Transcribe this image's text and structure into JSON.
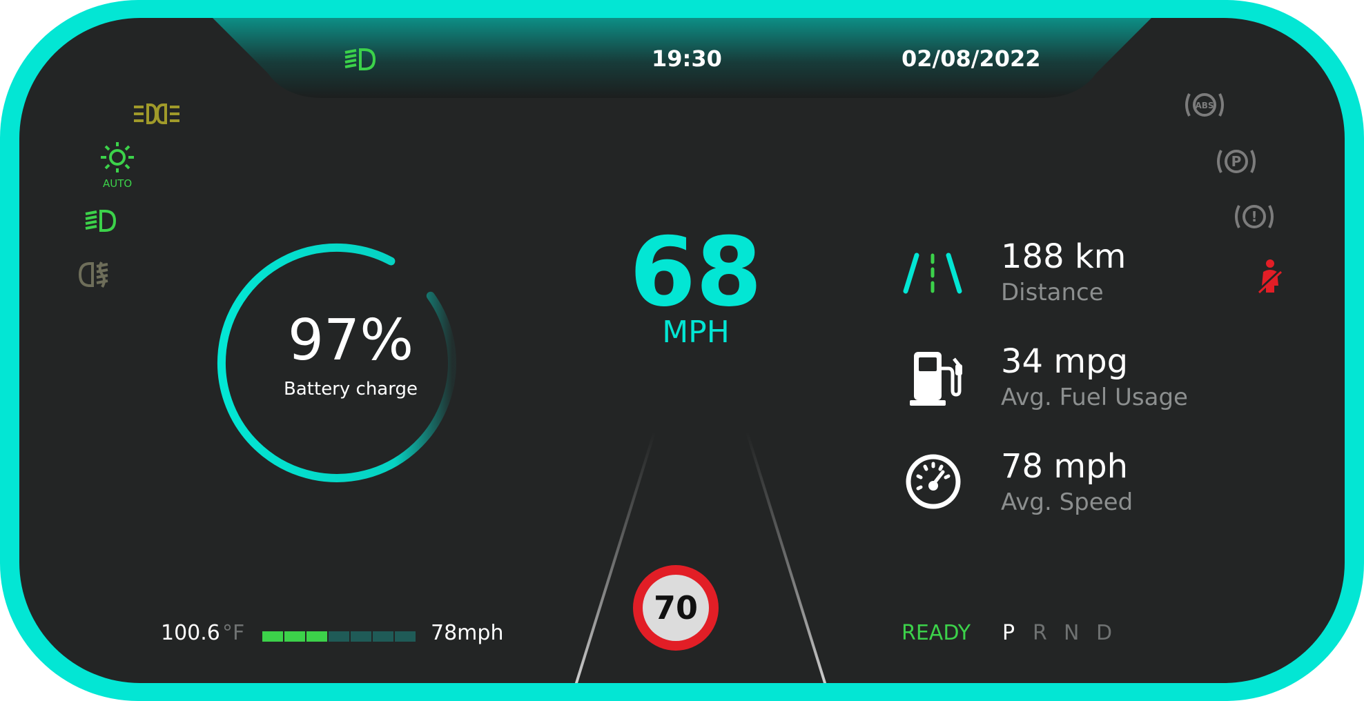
{
  "header": {
    "time": "19:30",
    "date": "02/08/2022"
  },
  "left_indicators": [
    {
      "icon": "parking-lights-icon",
      "color": "#a09a2a"
    },
    {
      "icon": "auto-headlights-icon",
      "color": "#3cd24a",
      "label": "AUTO"
    },
    {
      "icon": "low-beam-icon",
      "color": "#3cd24a"
    },
    {
      "icon": "fog-light-icon",
      "color": "#6e6e5a"
    }
  ],
  "right_indicators": [
    {
      "icon": "abs-warning-icon",
      "color": "#7c7c7c",
      "label": "ABS"
    },
    {
      "icon": "parking-brake-icon",
      "color": "#7c7c7c",
      "label": "P"
    },
    {
      "icon": "brake-warning-icon",
      "color": "#7c7c7c",
      "label": "!"
    },
    {
      "icon": "seatbelt-warning-icon",
      "color": "#e21e26"
    }
  ],
  "battery": {
    "percent_label": "97%",
    "label": "Battery charge",
    "level": 0.97,
    "color": "#03e6d4"
  },
  "speed": {
    "value": "68",
    "unit": "MPH"
  },
  "stats": [
    {
      "value": "188 km",
      "label": "Distance",
      "icon": "road-lanes-icon"
    },
    {
      "value": "34 mpg",
      "label": "Avg. Fuel Usage",
      "icon": "fuel-pump-icon"
    },
    {
      "value": "78 mph",
      "label": "Avg. Speed",
      "icon": "speedometer-icon"
    }
  ],
  "speed_limit": {
    "value": "70"
  },
  "bottom_left": {
    "temperature": "100.6",
    "temperature_unit": "°F",
    "speed_text": "78mph",
    "bar_filled": 3,
    "bar_total": 7,
    "bar_filled_color": "#3cd24a",
    "bar_empty_color": "#1f5b57"
  },
  "drive": {
    "status": "READY",
    "status_color": "#3cd24a",
    "gears": [
      "P",
      "R",
      "N",
      "D"
    ],
    "active_gear": "P"
  },
  "colors": {
    "accent": "#03e6d4",
    "background": "#232525",
    "warning": "#e21e26"
  }
}
